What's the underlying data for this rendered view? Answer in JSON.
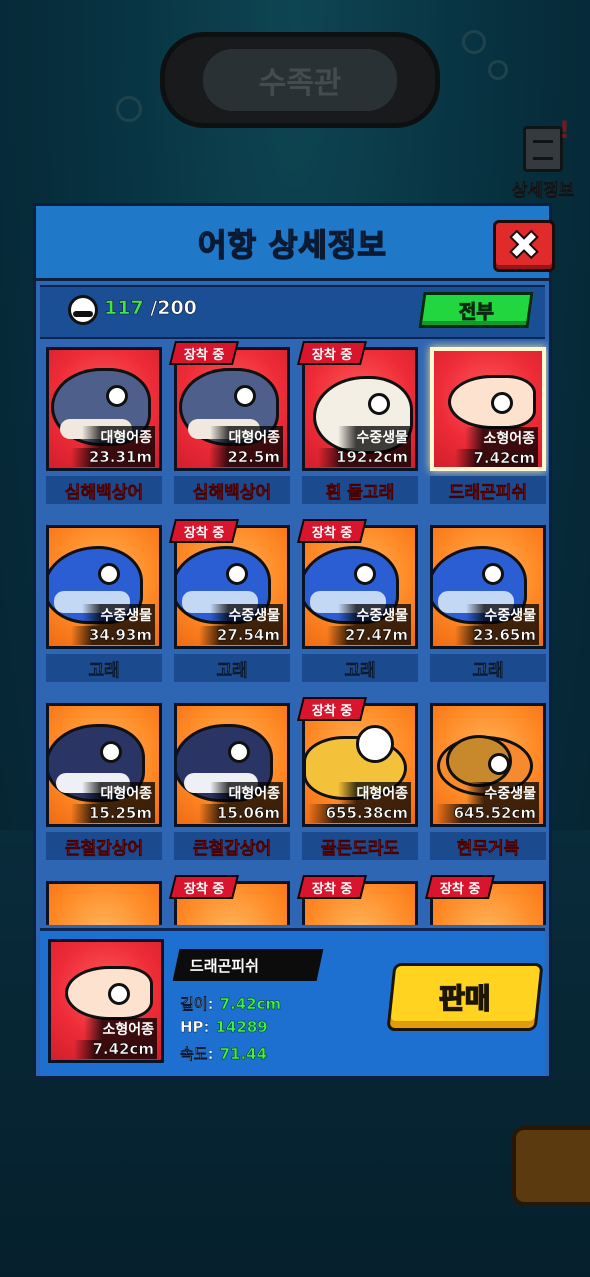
{
  "background": {
    "aquarium_sign": "수족관",
    "detail_button_label": "상세정보",
    "detail_alert": "!"
  },
  "modal": {
    "title": "어항 상세정보",
    "close_label": "✖",
    "capacity_current": "117",
    "capacity_max": "/200",
    "filter_label": "전부",
    "equipped_label": "장착 중"
  },
  "creatures": [
    {
      "name": "심해백상어",
      "type": "대형어종",
      "size": "23.31m",
      "bg": "red",
      "art": "shark",
      "equipped": false,
      "name_color": "red"
    },
    {
      "name": "심해백상어",
      "type": "대형어종",
      "size": "22.5m",
      "bg": "red",
      "art": "shark",
      "equipped": true,
      "name_color": "red"
    },
    {
      "name": "흰 돌고래",
      "type": "수중생물",
      "size": "192.2cm",
      "bg": "red",
      "art": "whale-white",
      "equipped": true,
      "name_color": "red"
    },
    {
      "name": "드래곤피쉬",
      "type": "소형어종",
      "size": "7.42cm",
      "bg": "red",
      "art": "fish-pale",
      "equipped": false,
      "name_color": "red",
      "selected": true
    },
    {
      "name": "고래",
      "type": "수중생물",
      "size": "34.93m",
      "bg": "orange",
      "art": "whale",
      "equipped": false,
      "name_color": "white"
    },
    {
      "name": "고래",
      "type": "수중생물",
      "size": "27.54m",
      "bg": "orange",
      "art": "whale",
      "equipped": true,
      "name_color": "white"
    },
    {
      "name": "고래",
      "type": "수중생물",
      "size": "27.47m",
      "bg": "orange",
      "art": "whale",
      "equipped": true,
      "name_color": "white"
    },
    {
      "name": "고래",
      "type": "수중생물",
      "size": "23.65m",
      "bg": "orange",
      "art": "whale",
      "equipped": false,
      "name_color": "white"
    },
    {
      "name": "큰철갑상어",
      "type": "대형어종",
      "size": "15.25m",
      "bg": "orange",
      "art": "orca",
      "equipped": false,
      "name_color": "red"
    },
    {
      "name": "큰철갑상어",
      "type": "대형어종",
      "size": "15.06m",
      "bg": "orange",
      "art": "orca",
      "equipped": false,
      "name_color": "red"
    },
    {
      "name": "골든도라도",
      "type": "대형어종",
      "size": "655.38cm",
      "bg": "orange",
      "art": "goldfish",
      "equipped": true,
      "name_color": "red"
    },
    {
      "name": "현무거북",
      "type": "수중생물",
      "size": "645.52cm",
      "bg": "orange",
      "art": "turtle",
      "equipped": false,
      "name_color": "red"
    },
    {
      "name": "",
      "type": "",
      "size": "",
      "bg": "orange",
      "art": "none",
      "equipped": false,
      "name_color": "white"
    },
    {
      "name": "",
      "type": "",
      "size": "",
      "bg": "orange",
      "art": "none",
      "equipped": true,
      "name_color": "white"
    },
    {
      "name": "",
      "type": "",
      "size": "",
      "bg": "orange",
      "art": "none",
      "equipped": true,
      "name_color": "white"
    },
    {
      "name": "",
      "type": "",
      "size": "",
      "bg": "orange",
      "art": "none",
      "equipped": true,
      "name_color": "white"
    }
  ],
  "selected": {
    "name": "드래곤피쉬",
    "type": "소형어종",
    "size": "7.42cm",
    "length_label": "길이:",
    "length_value": "7.42cm",
    "hp_label": "HP:",
    "hp_value": "14289",
    "speed_label": "속도:",
    "speed_value": "71.44",
    "sell_label": "판매"
  }
}
